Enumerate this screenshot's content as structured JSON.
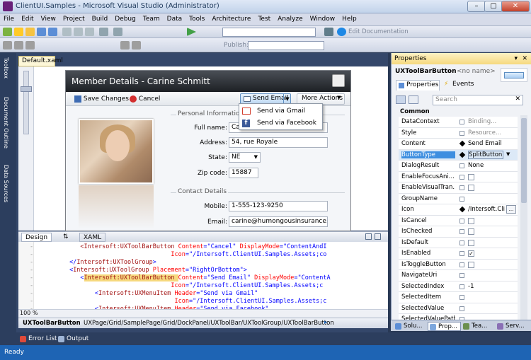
{
  "window": {
    "title": "ClientUI.Samples - Microsoft Visual Studio (Administrator)",
    "minimize": "–",
    "maximize": "▢",
    "close": "✕"
  },
  "menu": [
    "File",
    "Edit",
    "View",
    "Project",
    "Build",
    "Debug",
    "Team",
    "Data",
    "Tools",
    "Architecture",
    "Test",
    "Analyze",
    "Window",
    "Help"
  ],
  "toolbar": {
    "find_combo": "",
    "edit_doc": "Edit Documentation",
    "publish": "Publish:"
  },
  "rail": {
    "toolbox": "Toolbox",
    "doc_outline": "Document Outline",
    "data_sources": "Data Sources"
  },
  "document": {
    "tab": "Default.xaml"
  },
  "member": {
    "title": "Member Details - Carine Schmitt",
    "save": "Save Changes",
    "cancel": "Cancel",
    "send_email": "Send Email",
    "more_actions": "More Actions",
    "personal_section": "Personal Information",
    "full_name_label": "Full name:",
    "full_name_value": "Carine Schmitt",
    "address_label": "Address:",
    "address_value": "54, rue Royale",
    "state_label": "State:",
    "state_value": "NE",
    "zip_label": "Zip code:",
    "zip_value": "15887",
    "contact_section": "Contact Details",
    "mobile_label": "Mobile:",
    "mobile_value": "1-555-123-9250",
    "email_label": "Email:",
    "email_value": "carine@humongousinsurance.com"
  },
  "dropdown": {
    "gmail": "Send via Gmail",
    "facebook": "Send via Facebook"
  },
  "splitbar": {
    "design": "Design",
    "swap": "⇅",
    "xaml": "XAML"
  },
  "code": [
    {
      "indent": "            ",
      "parts": [
        [
          "tag",
          "<Intersoft:UXToolBarButton "
        ],
        [
          "attr",
          "Content"
        ],
        [
          "br",
          "=\"Cancel\" "
        ],
        [
          "attr",
          "DisplayMode"
        ],
        [
          "br",
          "=\"ContentAndI"
        ]
      ]
    },
    {
      "indent": "                                     ",
      "parts": [
        [
          "attr",
          "Icon"
        ],
        [
          "br",
          "=\"/Intersoft.ClientUI.Samples.Assets;co"
        ]
      ]
    },
    {
      "indent": "         ",
      "parts": [
        [
          "br",
          "</"
        ],
        [
          "tag",
          "Intersoft:UXToolGroup"
        ],
        [
          "br",
          ">"
        ]
      ]
    },
    {
      "indent": "         ",
      "parts": [
        [
          "br",
          "<"
        ],
        [
          "tag",
          "Intersoft:UXToolGroup "
        ],
        [
          "attr",
          "Placement"
        ],
        [
          "br",
          "=\"RightOrBottom\">"
        ]
      ]
    },
    {
      "indent": "            ",
      "parts": [
        [
          "br",
          "<"
        ],
        [
          "tag",
          "Intersoft:UXToolBarButton "
        ],
        [
          "attr",
          "Content"
        ],
        [
          "br",
          "=\"Send Email\" "
        ],
        [
          "attr",
          "DisplayMode"
        ],
        [
          "br",
          "=\"ContentA"
        ]
      ]
    },
    {
      "indent": "                                     ",
      "parts": [
        [
          "attr",
          "Icon"
        ],
        [
          "br",
          "=\"/Intersoft.ClientUI.Samples.Assets;c"
        ]
      ]
    },
    {
      "indent": "                ",
      "parts": [
        [
          "br",
          "<"
        ],
        [
          "tag",
          "Intersoft:UXMenuItem "
        ],
        [
          "attr",
          "Header"
        ],
        [
          "br",
          "=\"Send via Gmail\""
        ]
      ]
    },
    {
      "indent": "                                      ",
      "parts": [
        [
          "attr",
          "Icon"
        ],
        [
          "br",
          "=\"/Intersoft.ClientUI.Samples.Assets;c"
        ]
      ]
    },
    {
      "indent": "                ",
      "parts": [
        [
          "br",
          "<"
        ],
        [
          "tag",
          "Intersoft:UXMenuItem "
        ],
        [
          "attr",
          "Header"
        ],
        [
          "br",
          "=\"Send via Facebook\""
        ]
      ]
    }
  ],
  "zoom": "100 %",
  "breadcrumb": {
    "element": "UXToolBarButton",
    "path": "UXPage/Grid/SamplePage/Grid/DockPanel/UXToolBar/UXToolGroup/UXToolBarButton"
  },
  "properties": {
    "title": "Properties",
    "selected_type": "UXToolBarButton",
    "selected_name": "<no name>",
    "tab_props": "Properties",
    "tab_events": "Events",
    "search_placeholder": "Search",
    "category": "Common",
    "rows": [
      {
        "name": "DataContext",
        "value": "Binding...",
        "kind": "text-gray",
        "set": false
      },
      {
        "name": "Style",
        "value": "Resource...",
        "kind": "text-gray",
        "set": false
      },
      {
        "name": "Content",
        "value": "Send Email",
        "kind": "text",
        "set": true
      },
      {
        "name": "ButtonType",
        "value": "SplitButton",
        "kind": "combo",
        "set": true
      },
      {
        "name": "DialogResult",
        "value": "None",
        "kind": "text",
        "set": false
      },
      {
        "name": "EnableFocusAni...",
        "value": "",
        "kind": "check",
        "set": false
      },
      {
        "name": "EnableVisualTran...",
        "value": "",
        "kind": "check",
        "set": false
      },
      {
        "name": "GroupName",
        "value": "",
        "kind": "text",
        "set": false
      },
      {
        "name": "Icon",
        "value": "/Intersoft.Cli",
        "kind": "browse",
        "set": true
      },
      {
        "name": "IsCancel",
        "value": "",
        "kind": "check",
        "set": false
      },
      {
        "name": "IsChecked",
        "value": "",
        "kind": "check",
        "set": false
      },
      {
        "name": "IsDefault",
        "value": "",
        "kind": "check",
        "set": false
      },
      {
        "name": "IsEnabled",
        "value": "✓",
        "kind": "check",
        "set": false
      },
      {
        "name": "IsToggleButton",
        "value": "",
        "kind": "check",
        "set": false
      },
      {
        "name": "NavigateUri",
        "value": "",
        "kind": "text",
        "set": false
      },
      {
        "name": "SelectedIndex",
        "value": "-1",
        "kind": "text",
        "set": false
      },
      {
        "name": "SelectedItem",
        "value": "",
        "kind": "text",
        "set": false
      },
      {
        "name": "SelectedValue",
        "value": "",
        "kind": "text",
        "set": false
      },
      {
        "name": "SelectedValuePath",
        "value": "",
        "kind": "text",
        "set": false
      }
    ]
  },
  "bottom_tabs": [
    "Solu...",
    "Prop...",
    "Tea...",
    "Serv..."
  ],
  "output_tabs": [
    "Error List",
    "Output"
  ],
  "status": "Ready",
  "colors": {
    "status_bar": "#1e64b4",
    "chrome": "#293955",
    "highlight": "#f6d97e"
  }
}
